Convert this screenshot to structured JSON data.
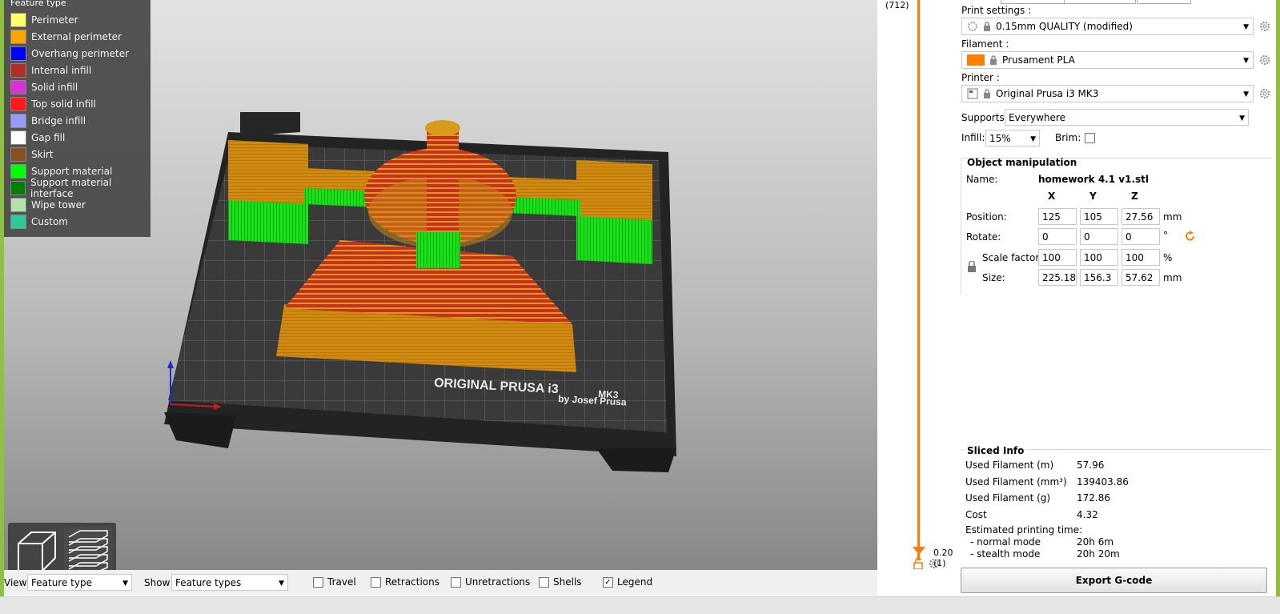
{
  "legend": {
    "title": "Feature type",
    "items": [
      {
        "label": "Perimeter",
        "color": "#ffff66"
      },
      {
        "label": "External perimeter",
        "color": "#ffa500"
      },
      {
        "label": "Overhang perimeter",
        "color": "#0000ff"
      },
      {
        "label": "Internal infill",
        "color": "#b03029"
      },
      {
        "label": "Solid infill",
        "color": "#d732d7"
      },
      {
        "label": "Top solid infill",
        "color": "#ff1a1a"
      },
      {
        "label": "Bridge infill",
        "color": "#9999ff"
      },
      {
        "label": "Gap fill",
        "color": "#ffffff"
      },
      {
        "label": "Skirt",
        "color": "#845321"
      },
      {
        "label": "Support material",
        "color": "#00ff00"
      },
      {
        "label": "Support material interface",
        "color": "#008000"
      },
      {
        "label": "Wipe tower",
        "color": "#b3e3ab"
      },
      {
        "label": "Custom",
        "color": "#28cc94"
      }
    ]
  },
  "bed": {
    "brand_line1": "ORIGINAL PRUSA i3",
    "brand_model": "MK3",
    "brand_line2": "by Josef Prusa"
  },
  "layer_slider": {
    "top_label": "(712)",
    "bottom_value": "0.20",
    "bottom_count": "(1)"
  },
  "settings": {
    "print_label": "Print settings :",
    "print_value": "0.15mm QUALITY (modified)",
    "filament_label": "Filament :",
    "filament_value": "Prusament PLA",
    "filament_color": "#ff8000",
    "printer_label": "Printer :",
    "printer_value": "Original Prusa i3 MK3",
    "supports_label": "Supports:",
    "supports_value": "Everywhere",
    "infill_label": "Infill:",
    "infill_value": "15%",
    "brim_label": "Brim:"
  },
  "object": {
    "group_title": "Object manipulation",
    "name_label": "Name:",
    "name_value": "homework 4.1 v1.stl",
    "axis_x": "X",
    "axis_y": "Y",
    "axis_z": "Z",
    "position_label": "Position:",
    "position": [
      "125",
      "105",
      "27.56"
    ],
    "position_unit": "mm",
    "rotate_label": "Rotate:",
    "rotate": [
      "0",
      "0",
      "0"
    ],
    "rotate_unit": "°",
    "scale_label": "Scale factors:",
    "scale": [
      "100",
      "100",
      "100"
    ],
    "scale_unit": "%",
    "size_label": "Size:",
    "size": [
      "225.18",
      "156.3",
      "57.62"
    ],
    "size_unit": "mm"
  },
  "sliced": {
    "title": "Sliced Info",
    "rows": [
      {
        "label": "Used Filament (m)",
        "value": "57.96"
      },
      {
        "label": "Used Filament (mm³)",
        "value": "139403.86"
      },
      {
        "label": "Used Filament (g)",
        "value": "172.86"
      },
      {
        "label": "Cost",
        "value": "4.32"
      }
    ],
    "est_label": "Estimated printing time:",
    "normal_label": "- normal mode",
    "normal_value": "20h 6m",
    "stealth_label": "- stealth mode",
    "stealth_value": "20h 20m"
  },
  "export_label": "Export G-code",
  "bottom": {
    "view_label": "View",
    "view_value": "Feature type",
    "show_label": "Show",
    "show_value": "Feature types",
    "travel": "Travel",
    "retractions": "Retractions",
    "unretractions": "Unretractions",
    "shells": "Shells",
    "legend": "Legend",
    "legend_checked": "✓"
  }
}
